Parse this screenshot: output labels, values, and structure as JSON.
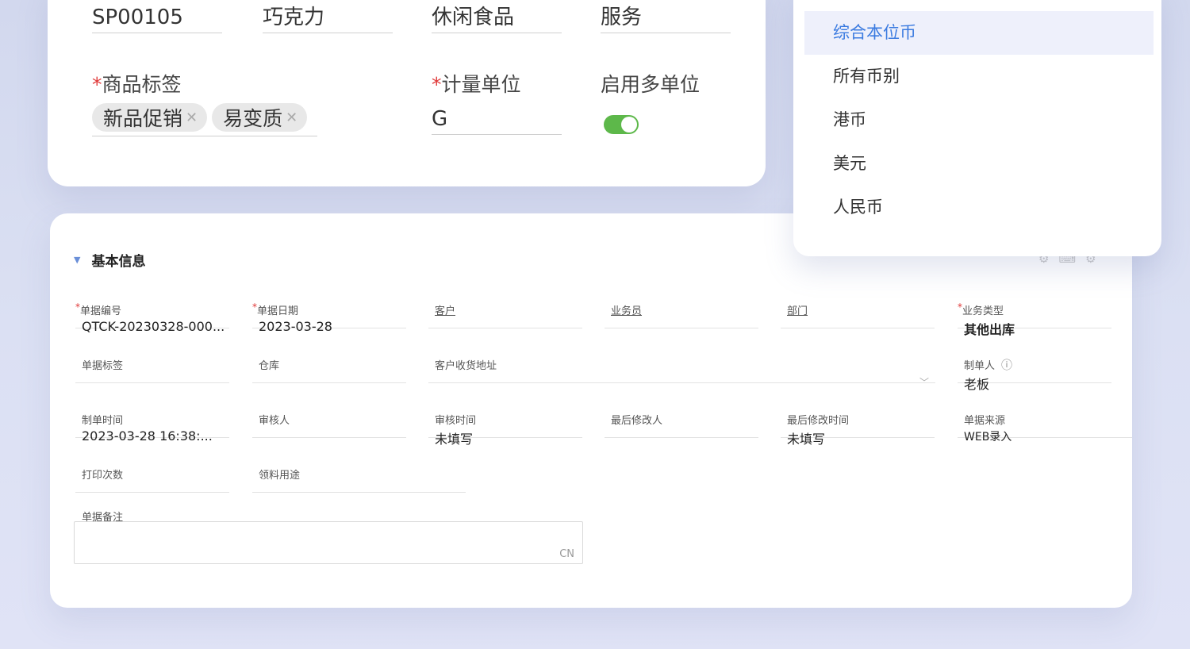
{
  "product_card": {
    "code": "SP00105",
    "name": "巧克力",
    "category": "休闲食品",
    "type": "服务",
    "tags_label": "商品标签",
    "tags": [
      "新品促销",
      "易变质"
    ],
    "unit_label": "计量单位",
    "unit_value": "G",
    "multi_unit_label": "启用多单位",
    "multi_unit_enabled": true
  },
  "currency_dropdown": {
    "options": [
      "综合本位币",
      "所有币别",
      "港币",
      "美元",
      "人民币"
    ],
    "selected": "综合本位币"
  },
  "form": {
    "section_title": "基本信息",
    "fields": {
      "doc_no": {
        "label": "单据编号",
        "value": "QTCK-20230328-000..."
      },
      "doc_date": {
        "label": "单据日期",
        "value": "2023-03-28"
      },
      "customer": {
        "label": "客户",
        "value": ""
      },
      "salesperson": {
        "label": "业务员",
        "value": ""
      },
      "department": {
        "label": "部门",
        "value": ""
      },
      "biz_type": {
        "label": "业务类型",
        "value": "其他出库"
      },
      "doc_tag": {
        "label": "单据标签",
        "value": ""
      },
      "warehouse": {
        "label": "仓库",
        "value": ""
      },
      "cust_addr": {
        "label": "客户收货地址",
        "value": ""
      },
      "creator": {
        "label": "制单人",
        "value": "老板"
      },
      "create_time": {
        "label": "制单时间",
        "value": "2023-03-28 16:38:..."
      },
      "auditor": {
        "label": "审核人",
        "value": ""
      },
      "audit_time": {
        "label": "审核时间",
        "value": "未填写"
      },
      "last_modifier": {
        "label": "最后修改人",
        "value": ""
      },
      "last_mod_time": {
        "label": "最后修改时间",
        "value": "未填写"
      },
      "doc_source": {
        "label": "单据来源",
        "value": "WEB录入"
      },
      "print_count": {
        "label": "打印次数",
        "value": ""
      },
      "usage": {
        "label": "领料用途",
        "value": ""
      }
    },
    "remark": {
      "label": "单据备注",
      "value": "",
      "lang_badge": "CN"
    }
  },
  "colors": {
    "accent": "#3b7be0",
    "toggle_on": "#5db84a",
    "required": "#e03a3a"
  }
}
